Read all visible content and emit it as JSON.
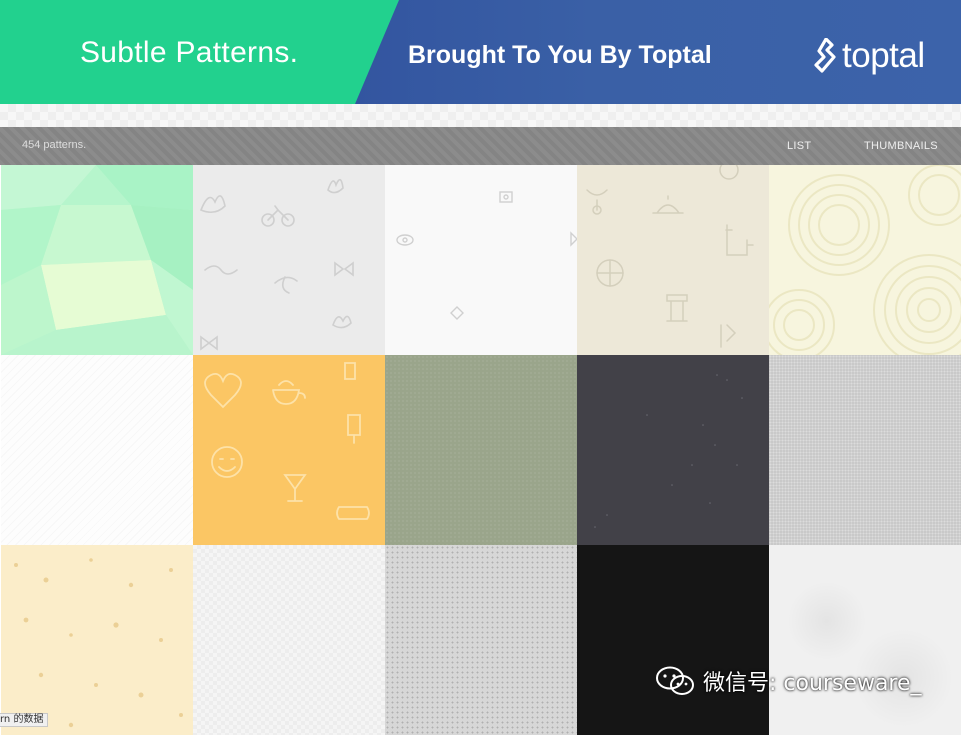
{
  "banner": {
    "site_title": "Subtle Patterns.",
    "tagline": "Brought To You By Toptal",
    "logo_text": "toptal",
    "colors": {
      "green": "#22d18e",
      "blue": "#3a60a6"
    }
  },
  "toolbar": {
    "count": "454 patterns.",
    "nav": {
      "list": "LIST",
      "thumbnails": "THUMBNAILS"
    }
  },
  "patterns": [
    {
      "color": "#b6f5cc",
      "icon": "geometric-polygons"
    },
    {
      "color": "#ebebeb",
      "icon": "doodle-icons"
    },
    {
      "color": "#f9f9f9",
      "icon": "small-symbols"
    },
    {
      "color": "#ede8d8",
      "icon": "doodle-icons"
    },
    {
      "color": "#f7f5de",
      "icon": "swirl-ornament"
    },
    {
      "color": "#fdfdfd",
      "icon": "fine-diagonal-texture"
    },
    {
      "color": "#fbc664",
      "icon": "doodle-icons"
    },
    {
      "color": "#9aa58b",
      "icon": "paper-texture"
    },
    {
      "color": "#424148",
      "icon": "speckle-texture"
    },
    {
      "color": "#c9c9c9",
      "icon": "dot-texture"
    },
    {
      "color": "#fbedc9",
      "icon": "speckle-texture"
    },
    {
      "color": "#f5f5f5",
      "icon": "checker-texture"
    },
    {
      "color": "#d7d7d7",
      "icon": "noise-texture"
    },
    {
      "color": "#151515",
      "icon": "dark-texture"
    },
    {
      "color": "#f0f0f0",
      "icon": "marble-texture"
    }
  ],
  "watermark": {
    "text": "微信号: courseware_",
    "icon": "wechat-icon"
  },
  "status": {
    "text": "rn 的数据"
  }
}
